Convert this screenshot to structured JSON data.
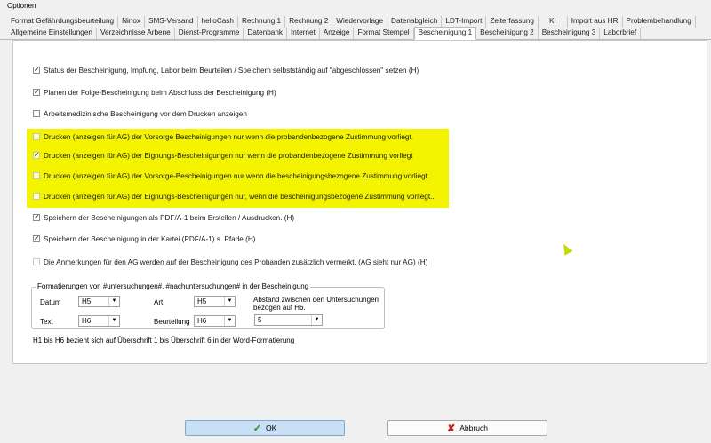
{
  "window": {
    "title": "Optionen"
  },
  "tabs_row1": [
    "Format Gefährdungsbeurteilung",
    "Ninox",
    "SMS-Versand",
    "helloCash",
    "Rechnung 1",
    "Rechnung 2",
    "Wiedervorlage",
    "Datenabgleich",
    "LDT-Import",
    "Zeiterfassung",
    "KI",
    "Import aus HR",
    "Problembehandlung"
  ],
  "tabs_row2": [
    "Allgemeine Einstellungen",
    "Verzeichnisse Arbene",
    "Dienst-Programme",
    "Datenbank",
    "Internet",
    "Anzeige",
    "Format Stempel",
    "Bescheinigung 1",
    "Bescheinigung 2",
    "Bescheinigung 3",
    "Laborbrief"
  ],
  "active_tab": "Bescheinigung 1",
  "options": [
    {
      "label": "Status der Bescheinigung, Impfung, Labor beim Beurteilen / Speichern  selbstständig auf \"abgeschlossen\" setzen (H)",
      "checked": true
    },
    {
      "label": "Planen der Folge-Bescheinigung beim Abschluss der  Bescheinigung (H)",
      "checked": true
    },
    {
      "label": "Arbeitsmedizinische Bescheinigung vor dem Drucken anzeigen",
      "checked": false
    },
    {
      "label": "Drucken (anzeigen für AG) der Vorsorge Bescheinigungen nur wenn die probandenbezogene Zustimmung vorliegt.",
      "checked": false
    },
    {
      "label": "Drucken (anzeigen für AG) der Eignungs-Bescheinigungen nur wenn die probandenbezogene Zustimmung vorliegt",
      "checked": true
    },
    {
      "label": "Drucken (anzeigen für AG) der Vorsorge-Bescheinigungen  nur wenn die bescheinigungsbezogene  Zustimmung vorliegt.",
      "checked": false
    },
    {
      "label": "Drucken (anzeigen für AG) der Eignungs-Bescheinigungen nur, wenn die bescheinigungsbezogene  Zustimmung vorliegt..",
      "checked": false
    },
    {
      "label": "Speichern der Bescheinigungen als PDF/A-1 beim Erstellen / Ausdrucken. (H)",
      "checked": true
    },
    {
      "label": "Speichern der Bescheinigung in der Kartei (PDF/A-1)  s. Pfade (H)",
      "checked": true
    },
    {
      "label": "Die Anmerkungen für den AG werden auf der Bescheinigung des Probanden zusätzlich vermerkt. (AG sieht nur AG) (H)",
      "checked": false
    }
  ],
  "format_group": {
    "legend": "Formatierungen von #untersuchungen#, #nachuntersuchungen# in der Bescheinigung",
    "datum_label": "Datum",
    "datum_value": "H5",
    "art_label": "Art",
    "art_value": "H5",
    "text_label": "Text",
    "text_value": "H6",
    "beurteilung_label": "Beurteilung",
    "beurteilung_value": "H6",
    "abstand_label": "Abstand zwischen den Untersuchungen bezogen auf H6.",
    "abstand_value": "5"
  },
  "footnote": "H1 bis H6 bezieht sich auf Überschrift 1 bis Überschrift 6 in der Word-Formatierung",
  "buttons": {
    "ok": "OK",
    "cancel": "Abbruch"
  },
  "colors": {
    "highlight": "#f4f400",
    "ok_bg": "#c9dff3"
  }
}
